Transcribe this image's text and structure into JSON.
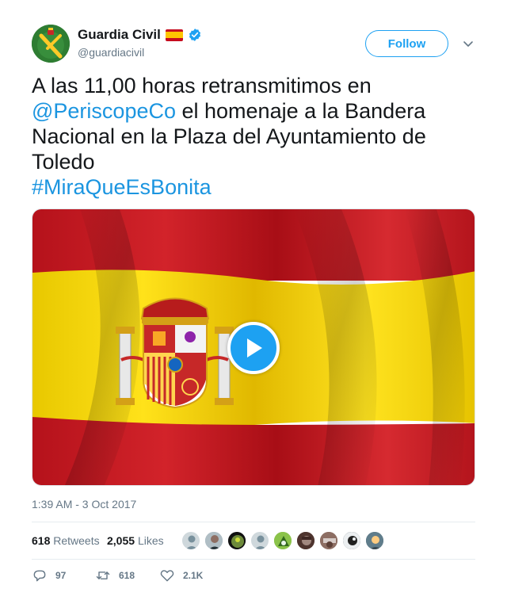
{
  "user": {
    "display_name": "Guardia Civil",
    "handle": "@guardiacivil",
    "verified": true,
    "flag_emoji": "spain-flag-icon"
  },
  "follow_button": {
    "label": "Follow"
  },
  "tweet": {
    "text_part1": "A las 11,00 horas retransmitimos en ",
    "mention": "@PeriscopeCo",
    "text_part2": " el homenaje a la Bandera Nacional en la Plaza del Ayuntamiento de Toledo",
    "hashtag": "#MiraQueEsBonita"
  },
  "media": {
    "type": "video",
    "icon": "play-icon"
  },
  "timestamp": "1:39 AM - 3 Oct 2017",
  "stats": {
    "retweets_count": "618",
    "retweets_label": "Retweets",
    "likes_count": "2,055",
    "likes_label": "Likes"
  },
  "actions": {
    "replies": "97",
    "retweets": "618",
    "likes": "2.1K"
  },
  "colors": {
    "accent": "#1da1f2",
    "link": "#1b95e0",
    "muted": "#657786",
    "text": "#14171a"
  }
}
